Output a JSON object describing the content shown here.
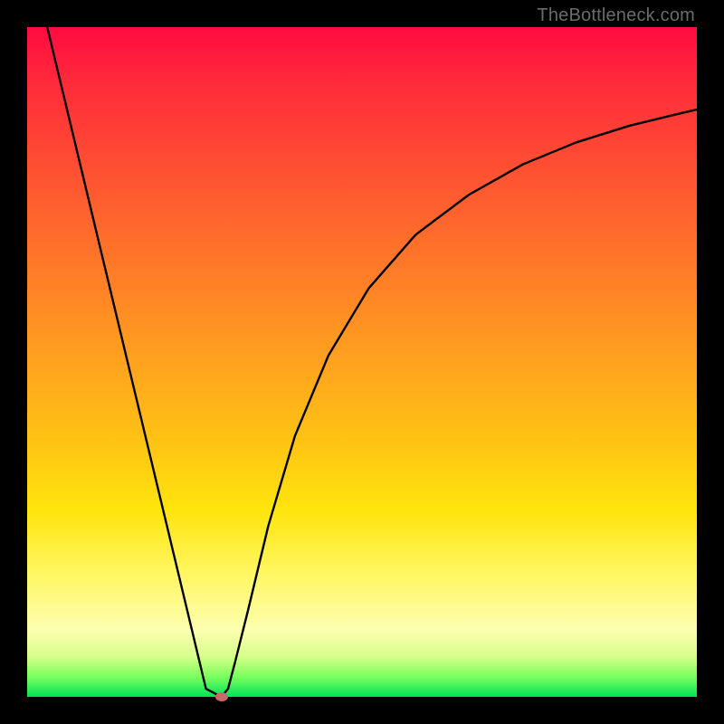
{
  "watermark": "TheBottleneck.com",
  "chart_data": {
    "type": "line",
    "title": "",
    "xlabel": "",
    "ylabel": "",
    "xlim": [
      0,
      1
    ],
    "ylim": [
      0,
      1
    ],
    "series": [
      {
        "name": "curve",
        "x": [
          0.03,
          0.06,
          0.09,
          0.12,
          0.15,
          0.18,
          0.21,
          0.24,
          0.267,
          0.29,
          0.3,
          0.31,
          0.33,
          0.36,
          0.4,
          0.45,
          0.51,
          0.58,
          0.66,
          0.74,
          0.82,
          0.9,
          0.97,
          1.0
        ],
        "y": [
          1.0,
          0.875,
          0.75,
          0.625,
          0.5,
          0.375,
          0.25,
          0.125,
          0.012,
          0.0,
          0.012,
          0.05,
          0.13,
          0.255,
          0.39,
          0.51,
          0.61,
          0.69,
          0.75,
          0.795,
          0.828,
          0.853,
          0.87,
          0.877
        ]
      }
    ],
    "marker": {
      "x": 0.29,
      "y": 0.0
    },
    "gradient_stops": [
      {
        "pos": 0.0,
        "color": "#ff0b3f"
      },
      {
        "pos": 0.5,
        "color": "#ffa21e"
      },
      {
        "pos": 0.82,
        "color": "#fdffb0"
      },
      {
        "pos": 1.0,
        "color": "#00e258"
      }
    ]
  }
}
